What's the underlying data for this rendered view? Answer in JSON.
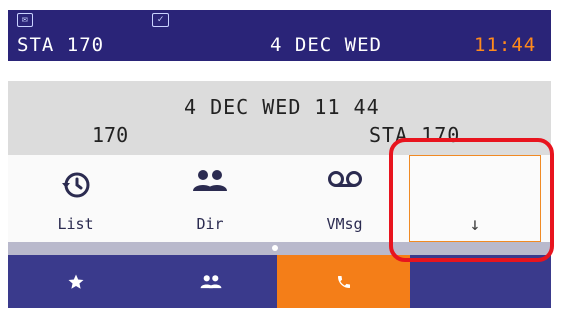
{
  "status_bar": {
    "station": "STA 170",
    "date": "4 DEC WED",
    "time": "11:44",
    "time_color": "#ff8a1c"
  },
  "info": {
    "datetime": "4 DEC WED 11 44",
    "left_number": "170",
    "right_station": "STA 170"
  },
  "softkeys": [
    {
      "label": "List",
      "icon": "history-icon"
    },
    {
      "label": "Dir",
      "icon": "people-icon"
    },
    {
      "label": "VMsg",
      "icon": "voicemail-icon"
    },
    {
      "label": "↓",
      "icon": "down-arrow",
      "highlighted": true
    }
  ],
  "pager": {
    "active_page": 1
  },
  "tabs": [
    {
      "icon": "star-icon",
      "active": false
    },
    {
      "icon": "people-icon",
      "active": false
    },
    {
      "icon": "phone-icon",
      "active": true
    },
    {
      "icon": "",
      "active": false
    }
  ],
  "colors": {
    "header": "#2a2478",
    "tab_bar": "#3a3a8c",
    "active_tab": "#f47e18",
    "highlight": "#e8141e"
  }
}
